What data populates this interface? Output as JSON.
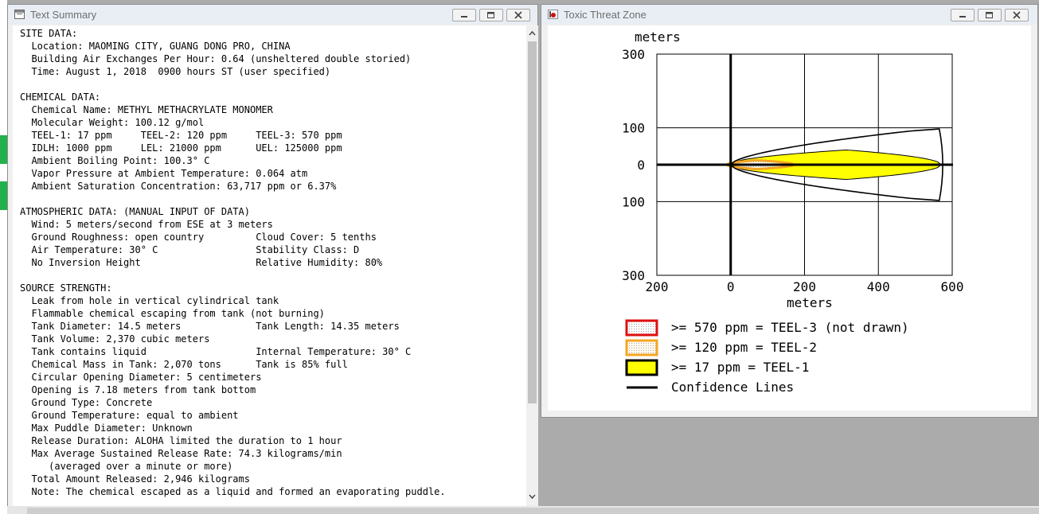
{
  "text_window": {
    "title": "Text Summary",
    "lines": [
      "SITE DATA:",
      "  Location: MAOMING CITY, GUANG DONG PRO, CHINA",
      "  Building Air Exchanges Per Hour: 0.64 (unsheltered double storied)",
      "  Time: August 1, 2018  0900 hours ST (user specified)",
      "",
      "CHEMICAL DATA:",
      "  Chemical Name: METHYL METHACRYLATE MONOMER",
      "  Molecular Weight: 100.12 g/mol",
      "  TEEL-1: 17 ppm     TEEL-2: 120 ppm     TEEL-3: 570 ppm",
      "  IDLH: 1000 ppm     LEL: 21000 ppm      UEL: 125000 ppm",
      "  Ambient Boiling Point: 100.3° C",
      "  Vapor Pressure at Ambient Temperature: 0.064 atm",
      "  Ambient Saturation Concentration: 63,717 ppm or 6.37%",
      "",
      "ATMOSPHERIC DATA: (MANUAL INPUT OF DATA)",
      "  Wind: 5 meters/second from ESE at 3 meters",
      "  Ground Roughness: open country         Cloud Cover: 5 tenths",
      "  Air Temperature: 30° C                 Stability Class: D",
      "  No Inversion Height                    Relative Humidity: 80%",
      "",
      "SOURCE STRENGTH:",
      "  Leak from hole in vertical cylindrical tank",
      "  Flammable chemical escaping from tank (not burning)",
      "  Tank Diameter: 14.5 meters             Tank Length: 14.35 meters",
      "  Tank Volume: 2,370 cubic meters",
      "  Tank contains liquid                   Internal Temperature: 30° C",
      "  Chemical Mass in Tank: 2,070 tons      Tank is 85% full",
      "  Circular Opening Diameter: 5 centimeters",
      "  Opening is 7.18 meters from tank bottom",
      "  Ground Type: Concrete",
      "  Ground Temperature: equal to ambient",
      "  Max Puddle Diameter: Unknown",
      "  Release Duration: ALOHA limited the duration to 1 hour",
      "  Max Average Sustained Release Rate: 74.3 kilograms/min",
      "     (averaged over a minute or more)",
      "  Total Amount Released: 2,946 kilograms",
      "  Note: The chemical escaped as a liquid and formed an evaporating puddle."
    ]
  },
  "threat_window": {
    "title": "Toxic Threat Zone",
    "y_unit": "meters",
    "x_unit": "meters",
    "y_ticks": [
      "300",
      "100",
      "0",
      "100",
      "300"
    ],
    "x_ticks": [
      "200",
      "0",
      "200",
      "400",
      "600"
    ],
    "legend": [
      {
        "label": ">= 570 ppm = TEEL-3 (not drawn)",
        "color": "#e01010"
      },
      {
        "label": ">= 120 ppm = TEEL-2",
        "color": "#f5a623"
      },
      {
        "label": ">= 17 ppm = TEEL-1",
        "color": "#ffff00"
      },
      {
        "label": "Confidence Lines",
        "color": "#000000"
      }
    ]
  },
  "chart_data": {
    "type": "area",
    "x": [
      -200,
      0,
      200,
      400,
      600
    ],
    "xlim": [
      -200,
      600
    ],
    "ylim": [
      -300,
      300
    ],
    "xlabel": "meters",
    "ylabel": "meters",
    "grid": true,
    "zones": [
      {
        "name": ">= 17 ppm = TEEL-1",
        "color": "#ffff00",
        "x_start": 0,
        "x_end": 570,
        "max_half_width": 40
      },
      {
        "name": ">= 120 ppm = TEEL-2",
        "color": "#f5a623",
        "x_start": -10,
        "x_end": 170,
        "max_half_width": 12
      },
      {
        "name": ">= 570 ppm = TEEL-3 (not drawn)",
        "color": "#e01010",
        "drawn": false
      }
    ],
    "confidence_lines": {
      "x_start": 0,
      "x_end": 575,
      "max_half_width": 100
    }
  }
}
